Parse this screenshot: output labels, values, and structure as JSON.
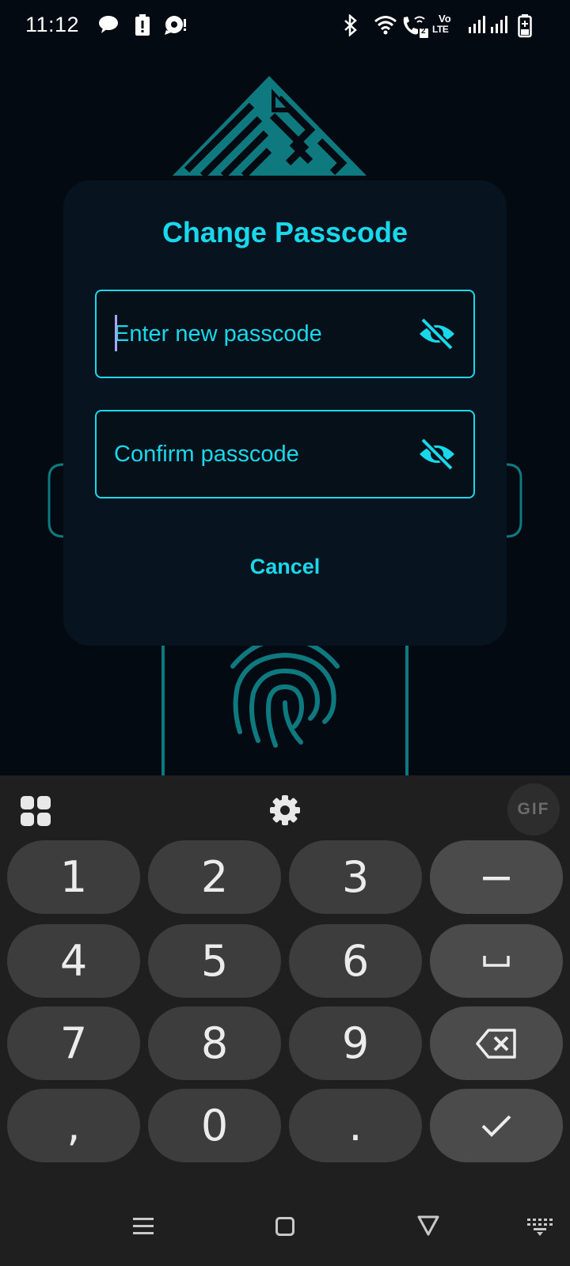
{
  "status_bar": {
    "time": "11:12",
    "icons": [
      "chat-icon",
      "alert-icon",
      "bubble-icon",
      "bluetooth-icon",
      "wifi-icon",
      "wifi-call-icon",
      "volte-icon",
      "signal-icon",
      "signal-icon",
      "battery-charging-icon"
    ],
    "volte_top": "Vo",
    "volte_bottom": "LTE",
    "sim_badge": "2"
  },
  "dialog": {
    "title": "Change Passcode",
    "new_passcode": {
      "value": "",
      "placeholder": "Enter new passcode"
    },
    "confirm_passcode": {
      "value": "",
      "placeholder": "Confirm passcode"
    },
    "cancel_label": "Cancel"
  },
  "keyboard": {
    "toolbar": {
      "gif_label": "GIF"
    },
    "keys": {
      "k1": "1",
      "k2": "2",
      "k3": "3",
      "minus": "−",
      "k4": "4",
      "k5": "5",
      "k6": "6",
      "k7": "7",
      "k8": "8",
      "k9": "9",
      "comma": ",",
      "k0": "0",
      "period": "."
    }
  },
  "navigation": {
    "buttons": [
      "recents-icon",
      "home-icon",
      "back-icon",
      "keyboard-switch-icon"
    ]
  },
  "colors": {
    "accent": "#19d8ec",
    "logo_teal": "#0e7a80",
    "background": "#030a12",
    "dialog": "#071420",
    "keyboard_bg": "#1f1f1f",
    "key": "#3d3d3d",
    "function_key": "#4b4b4b"
  }
}
